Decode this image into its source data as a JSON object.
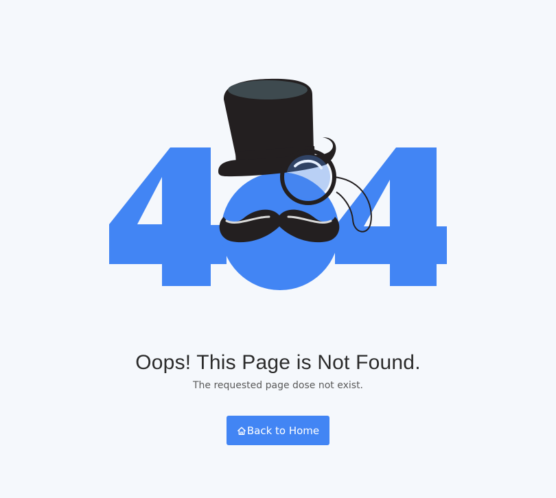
{
  "error": {
    "code_digit_left": "4",
    "code_digit_right": "4",
    "headline": "Oops! This Page is Not Found.",
    "message": "The requested page dose not exist."
  },
  "actions": {
    "back_home_label": "Back to Home",
    "back_home_icon": "home-icon"
  },
  "colors": {
    "background": "#f5f8fc",
    "accent": "#4285f4",
    "hat": "#231f20",
    "hat_top": "#3e4a4f",
    "text_primary": "#2b2b2b",
    "text_secondary": "#5a5a5a"
  }
}
